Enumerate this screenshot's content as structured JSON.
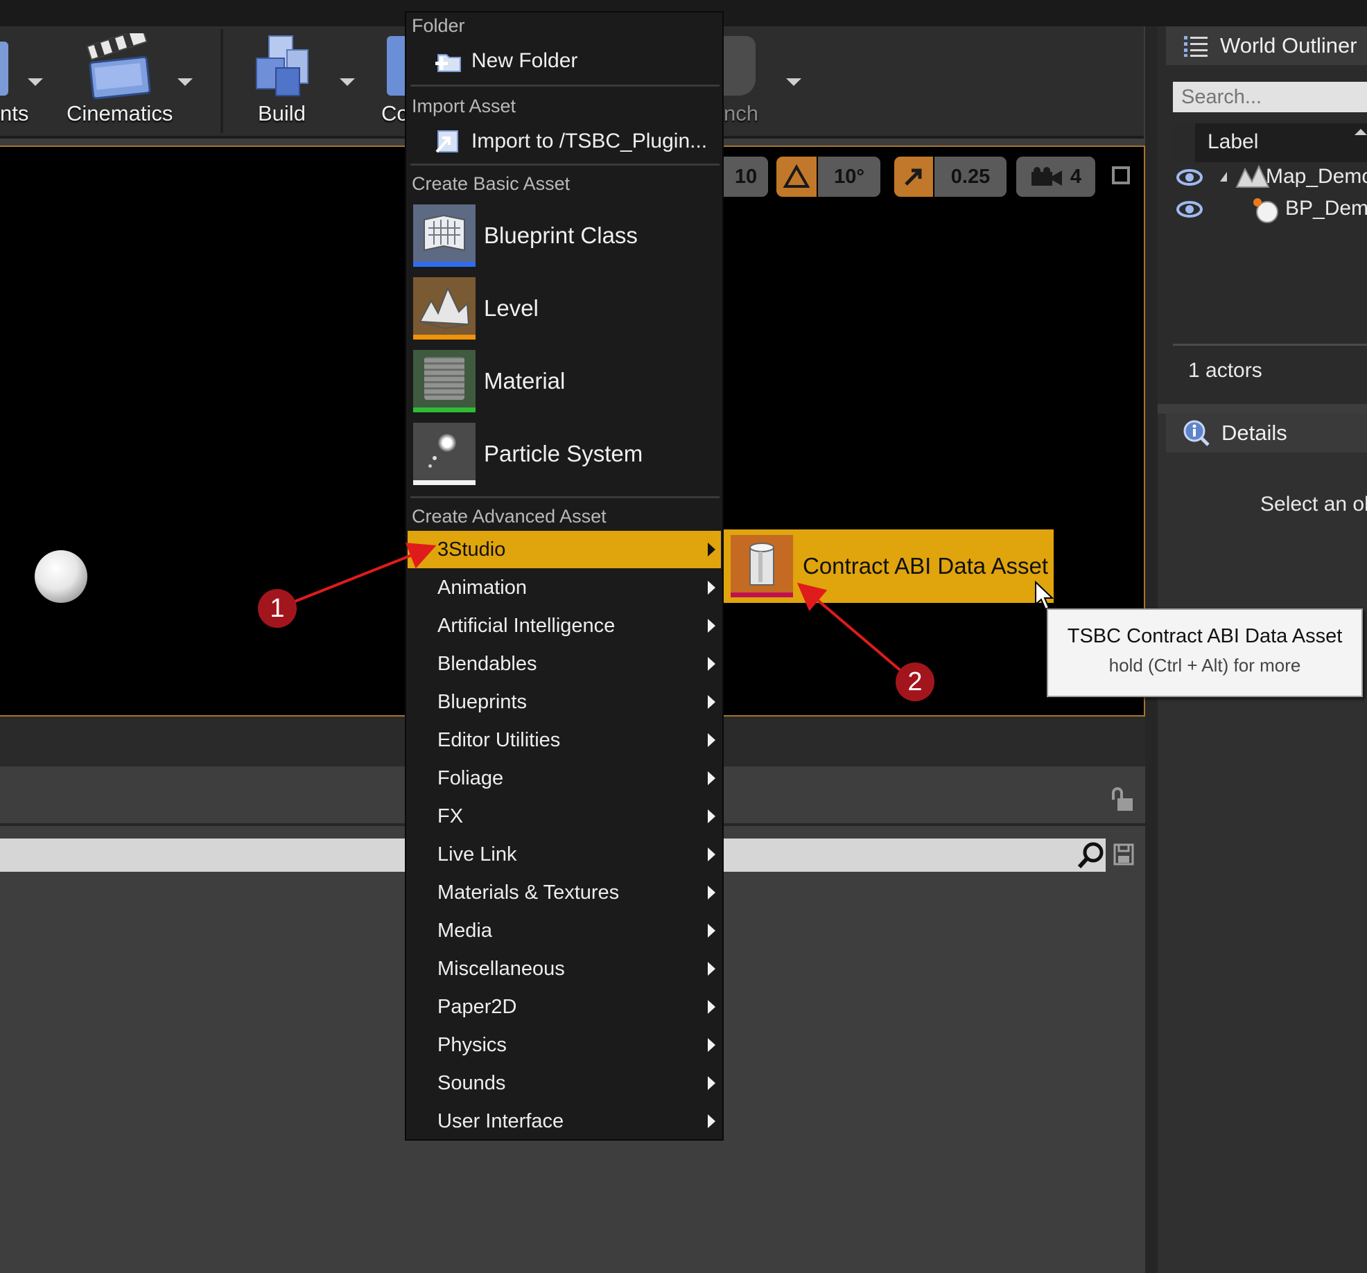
{
  "toolbar": {
    "partial_left_label": "nts",
    "cinematics_label": "Cinematics",
    "build_label": "Build",
    "partial_co_label": "Co",
    "partial_launch_label": "nch"
  },
  "viewport_toolbar": {
    "grid_snap_value": "10",
    "rotation_snap_value": "10°",
    "scale_snap_value": "0.25",
    "camera_speed_value": "4"
  },
  "context_menu": {
    "folder_section": "Folder",
    "new_folder": "New Folder",
    "import_section": "Import Asset",
    "import_to": "Import to /TSBC_Plugin...",
    "basic_section": "Create Basic Asset",
    "basic_items": [
      "Blueprint Class",
      "Level",
      "Material",
      "Particle System"
    ],
    "advanced_section": "Create Advanced Asset",
    "advanced_items": [
      "3Studio",
      "Animation",
      "Artificial Intelligence",
      "Blendables",
      "Blueprints",
      "Editor Utilities",
      "Foliage",
      "FX",
      "Live Link",
      "Materials & Textures",
      "Media",
      "Miscellaneous",
      "Paper2D",
      "Physics",
      "Sounds",
      "User Interface"
    ],
    "highlighted_index": 0
  },
  "submenu": {
    "item_label": "Contract ABI Data Asset"
  },
  "tooltip": {
    "title": "TSBC Contract ABI Data Asset",
    "hint": "hold (Ctrl + Alt) for more"
  },
  "world_outliner": {
    "title": "World Outliner",
    "search_placeholder": "Search...",
    "column_label": "Label",
    "rows": [
      "Map_Demo",
      "BP_Dem"
    ],
    "actor_count": "1 actors"
  },
  "details": {
    "title": "Details",
    "empty_text": "Select an ob"
  },
  "callouts": [
    "1",
    "2"
  ],
  "colors": {
    "highlight": "#e0a40d",
    "callout": "#a3151d",
    "arrow": "#e01b1b",
    "viewport_border": "#a8742c"
  }
}
